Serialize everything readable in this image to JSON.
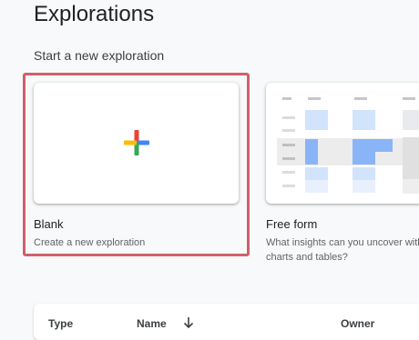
{
  "page": {
    "title": "Explorations"
  },
  "start_section": {
    "title": "Start a new exploration"
  },
  "templates": [
    {
      "label": "Blank",
      "description": "Create a new exploration",
      "icon": "google-plus-icon",
      "selected": true
    },
    {
      "label": "Free form",
      "description": "What insights can you uncover with charts and tables?",
      "icon": "freeform-table-thumbnail"
    }
  ],
  "table": {
    "columns": [
      "Type",
      "Name",
      "Owner"
    ],
    "sort_icon": "arrow-down-icon"
  },
  "colors": {
    "selection_border": "#d0606a",
    "plus_blue": "#4285f4",
    "plus_red": "#ea4335",
    "plus_yellow": "#fbbc04",
    "plus_green": "#34a853"
  }
}
